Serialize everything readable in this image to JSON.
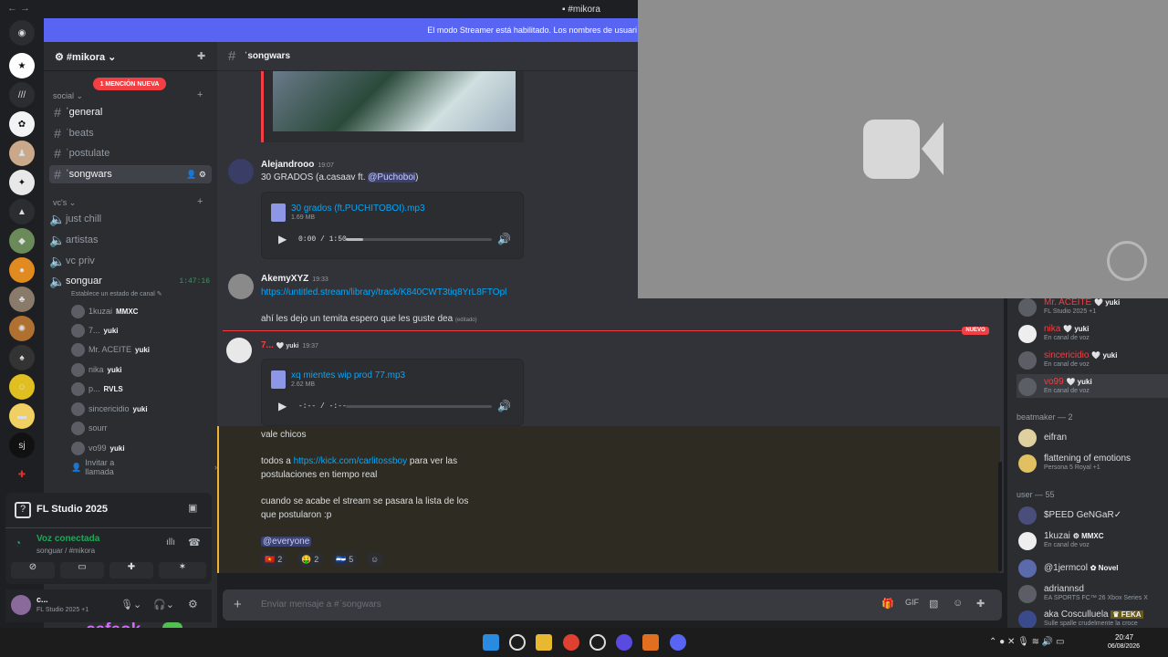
{
  "window": {
    "title": "#mikora",
    "nav": "←  →"
  },
  "banner": "El modo Streamer está habilitado. Los nombres de usuari",
  "colors": {
    "accent": "#5865f2",
    "bg": "#313338",
    "sidebar": "#2b2d31",
    "mention": "#f23f43",
    "link": "#00a8fc",
    "online": "#23a55a"
  },
  "server": {
    "name": "#mikora",
    "mention_badge": "1 MENCIÓN NUEVA"
  },
  "categories": {
    "social": "social",
    "vc": "vc's"
  },
  "text_channels": [
    {
      "name": "ˈgeneral"
    },
    {
      "name": "ˈbeats"
    },
    {
      "name": "ˈpostulate"
    },
    {
      "name": "ˈsongwars"
    }
  ],
  "voice_channels": [
    {
      "name": "just chill"
    },
    {
      "name": "artistas"
    },
    {
      "name": "vc priv"
    },
    {
      "name": "songuar",
      "timer": "1:47:16",
      "status": "Establece un estado de canal"
    }
  ],
  "voice_members": [
    {
      "name": "1kuzai",
      "tag": "MMXC"
    },
    {
      "name": "7...",
      "tag": "yuki"
    },
    {
      "name": "Mr. ACEITE",
      "tag": "yuki"
    },
    {
      "name": "nika",
      "tag": "yuki"
    },
    {
      "name": "p...",
      "tag": "RVLS"
    },
    {
      "name": "sincericidio",
      "tag": "yuki"
    },
    {
      "name": "sourr",
      "tag": ""
    },
    {
      "name": "vo99",
      "tag": "yuki"
    }
  ],
  "invite_label": "Invitar a llamada",
  "activity": {
    "name": "FL Studio 2025"
  },
  "voice_status": {
    "title": "Voz conectada",
    "sub": "songuar / #mikora"
  },
  "user": {
    "name": "c...",
    "status": "FL Studio 2025 +1"
  },
  "chat": {
    "channel": "ˈsongwars",
    "input_placeholder": "Enviar mensaje a #ˈsongwars",
    "new_label": "NUEVO",
    "messages": {
      "m1": {
        "author": "Alejandrooo",
        "time": "19:07",
        "text": "30 GRADOS (a.casaav ft. ",
        "mention": "@Puchoboi",
        "text_end": ")",
        "file": {
          "name": "30 grados (ft.PUCHITOBOI).mp3",
          "size": "1.69 MB",
          "time": "0:00 / 1:50"
        }
      },
      "m2": {
        "author": "AkemyXYZ",
        "time": "19:33",
        "link": "https://untitled.stream/library/track/K840CWT3tiq8YrL8FTOpl",
        "text": "ahí les dejo un temita espero que les guste dea",
        "edited": "(editado)"
      },
      "m3": {
        "author": "7...",
        "tag": "yuki",
        "time": "19:37",
        "file": {
          "name": "xq mientes wip prod 77.mp3",
          "size": "2.62 MB",
          "time": "-:-- / -:--"
        }
      },
      "m4": {
        "line1": "vale chicos",
        "line2a": "todos a ",
        "link": "https://kick.com/carlitossboy",
        "line2b": " para ver las",
        "line3": "postulaciones en tiempo real",
        "line4": "cuando se acabe el stream se pasara la lista de los",
        "line5": "que postularon :p",
        "mention": "@everyone",
        "reactions": [
          {
            "emoji": "🇻🇳",
            "count": "2"
          },
          {
            "emoji": "🤑",
            "count": "2"
          },
          {
            "emoji": "🇸🇻",
            "count": "5"
          }
        ]
      }
    }
  },
  "members": {
    "top": [
      {
        "name": "Mr. ACEITE",
        "tag": "yuki",
        "status": "FL Studio 2025 +1"
      },
      {
        "name": "nika",
        "tag": "yuki",
        "status": "En canal de voz"
      },
      {
        "name": "sincericidio",
        "tag": "yuki",
        "status": "En canal de voz"
      },
      {
        "name": "vo99",
        "tag": "yuki",
        "status": "En canal de voz"
      }
    ],
    "beatmaker_header": "beatmaker — 2",
    "beatmaker": [
      {
        "name": "eifran",
        "status": ""
      },
      {
        "name": "flattening of emotions",
        "status": "Persona 5 Royal +1"
      }
    ],
    "user_header": "user — 55",
    "user": [
      {
        "name": "$PEED GeNGaR✓",
        "tag": "",
        "status": ""
      },
      {
        "name": "1kuzai",
        "tag": "MMXC",
        "status": "En canal de voz"
      },
      {
        "name": "@1jermcol",
        "tag": "Novel",
        "status": ""
      },
      {
        "name": "adriannsd",
        "tag": "",
        "status": "EA SPORTS FC™ 26 Xbox Series X"
      },
      {
        "name": "aka Cosculluela",
        "tag": "FEKA",
        "status": "Sulle spalle crudelmente la croce"
      }
    ]
  },
  "overlay_text": "cafeok",
  "clock": {
    "time": "20:47",
    "date": "06/08/2026"
  }
}
